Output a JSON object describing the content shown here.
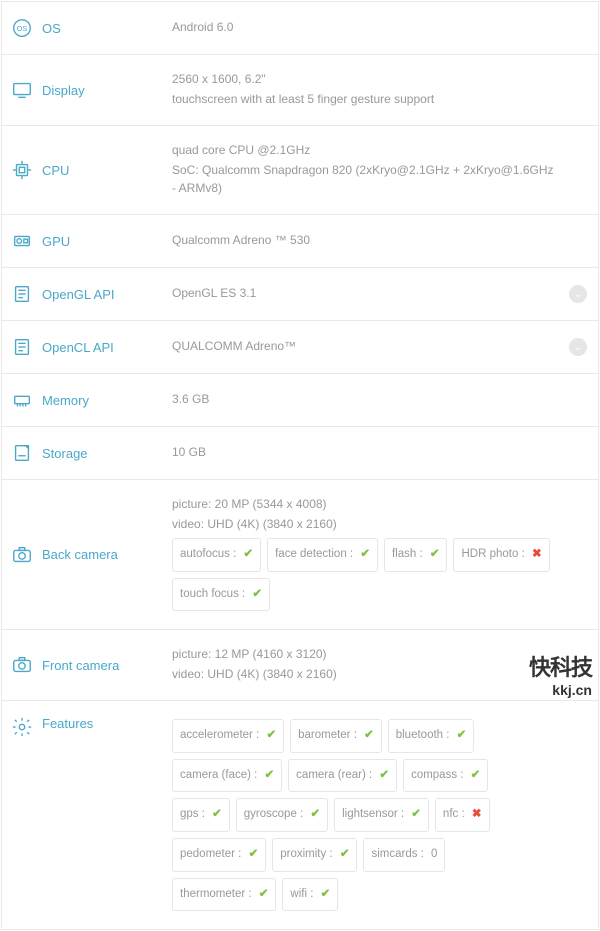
{
  "colors": {
    "accent": "#4aa8c9",
    "ok": "#7fc241",
    "bad": "#e74c3c"
  },
  "watermark": {
    "cn": "快科技",
    "url": "kkj.cn"
  },
  "specs": {
    "os": {
      "label": "OS",
      "lines": [
        "Android 6.0"
      ]
    },
    "display": {
      "label": "Display",
      "lines": [
        "2560 x 1600, 6.2\"",
        "touchscreen with at least 5 finger gesture support"
      ]
    },
    "cpu": {
      "label": "CPU",
      "lines": [
        "quad core CPU @2.1GHz",
        "SoC: Qualcomm Snapdragon 820 (2xKryo@2.1GHz + 2xKryo@1.6GHz - ARMv8)"
      ]
    },
    "gpu": {
      "label": "GPU",
      "lines": [
        "Qualcomm Adreno ™ 530"
      ]
    },
    "opengl": {
      "label": "OpenGL API",
      "lines": [
        "OpenGL ES 3.1"
      ],
      "expand": true
    },
    "opencl": {
      "label": "OpenCL API",
      "lines": [
        "QUALCOMM Adreno™"
      ],
      "expand": true
    },
    "memory": {
      "label": "Memory",
      "lines": [
        "3.6 GB"
      ]
    },
    "storage": {
      "label": "Storage",
      "lines": [
        "10 GB"
      ]
    },
    "backcam": {
      "label": "Back camera",
      "lines": [
        "picture: 20 MP (5344 x 4008)",
        "video: UHD (4K) (3840 x 2160)"
      ],
      "chips": [
        {
          "t": "autofocus :",
          "s": "ok"
        },
        {
          "t": "face detection :",
          "s": "ok"
        },
        {
          "t": "flash :",
          "s": "ok"
        },
        {
          "t": "HDR photo :",
          "s": "bad"
        },
        {
          "t": "touch focus :",
          "s": "ok"
        }
      ]
    },
    "frontcam": {
      "label": "Front camera",
      "lines": [
        "picture: 12 MP (4160 x 3120)",
        "video: UHD (4K) (3840 x 2160)"
      ]
    },
    "features": {
      "label": "Features",
      "chips": [
        {
          "t": "accelerometer :",
          "s": "ok"
        },
        {
          "t": "barometer :",
          "s": "ok"
        },
        {
          "t": "bluetooth :",
          "s": "ok"
        },
        {
          "t": "camera (face) :",
          "s": "ok"
        },
        {
          "t": "camera (rear) :",
          "s": "ok"
        },
        {
          "t": "compass :",
          "s": "ok"
        },
        {
          "t": "gps :",
          "s": "ok"
        },
        {
          "t": "gyroscope :",
          "s": "ok"
        },
        {
          "t": "lightsensor :",
          "s": "ok"
        },
        {
          "t": "nfc :",
          "s": "bad"
        },
        {
          "t": "pedometer :",
          "s": "ok"
        },
        {
          "t": "proximity :",
          "s": "ok"
        },
        {
          "t": "simcards :",
          "s": "zero",
          "v": "0"
        },
        {
          "t": "thermometer :",
          "s": "ok"
        },
        {
          "t": "wifi :",
          "s": "ok"
        }
      ]
    }
  }
}
